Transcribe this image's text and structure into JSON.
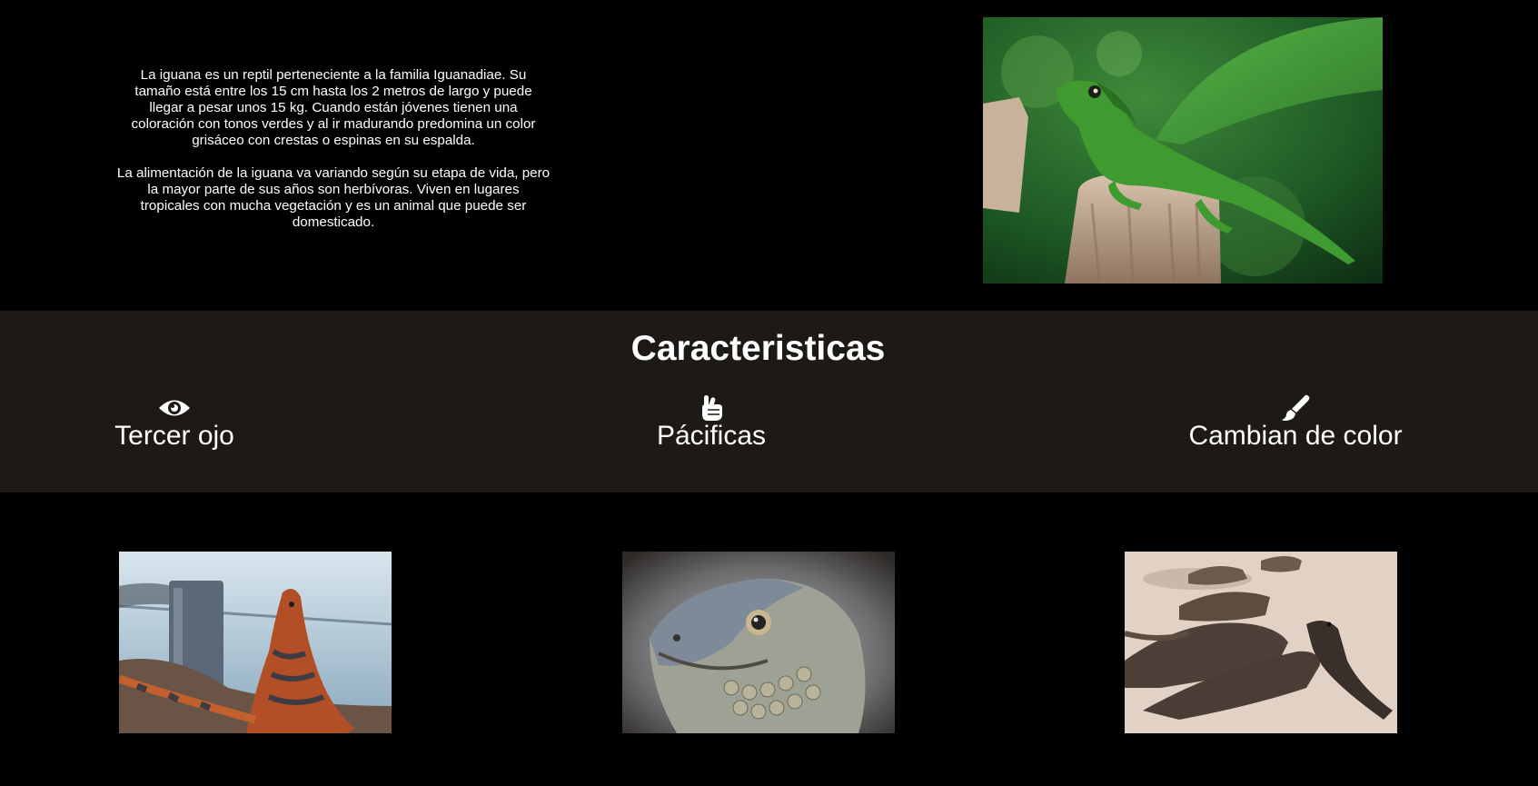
{
  "intro": {
    "paragraph_1": "La iguana es un reptil perteneciente a la familia Iguanadiae. Su tamaño está entre los 15 cm hasta los 2 metros de largo y puede llegar a pesar unos 15 kg. Cuando están jóvenes tienen una coloración con tonos verdes y al ir madurando predomina un color grisáceo con crestas o espinas en su espalda.",
    "paragraph_2": "La alimentación de la iguana va variando según su etapa de vida, pero la mayor parte de sus años son herbívoras. Viven en lugares tropicales con mucha vegetación y es un animal que puede ser domesticado."
  },
  "features": {
    "title": "Caracteristicas",
    "items": [
      {
        "icon": "eye-icon",
        "label": "Tercer ojo"
      },
      {
        "icon": "peace-hand-icon",
        "label": "Pácificas"
      },
      {
        "icon": "paint-brush-icon",
        "label": "Cambian de color"
      }
    ]
  },
  "colors": {
    "page_background": "#000000",
    "features_background": "#1d1915",
    "text": "#ffffff"
  }
}
